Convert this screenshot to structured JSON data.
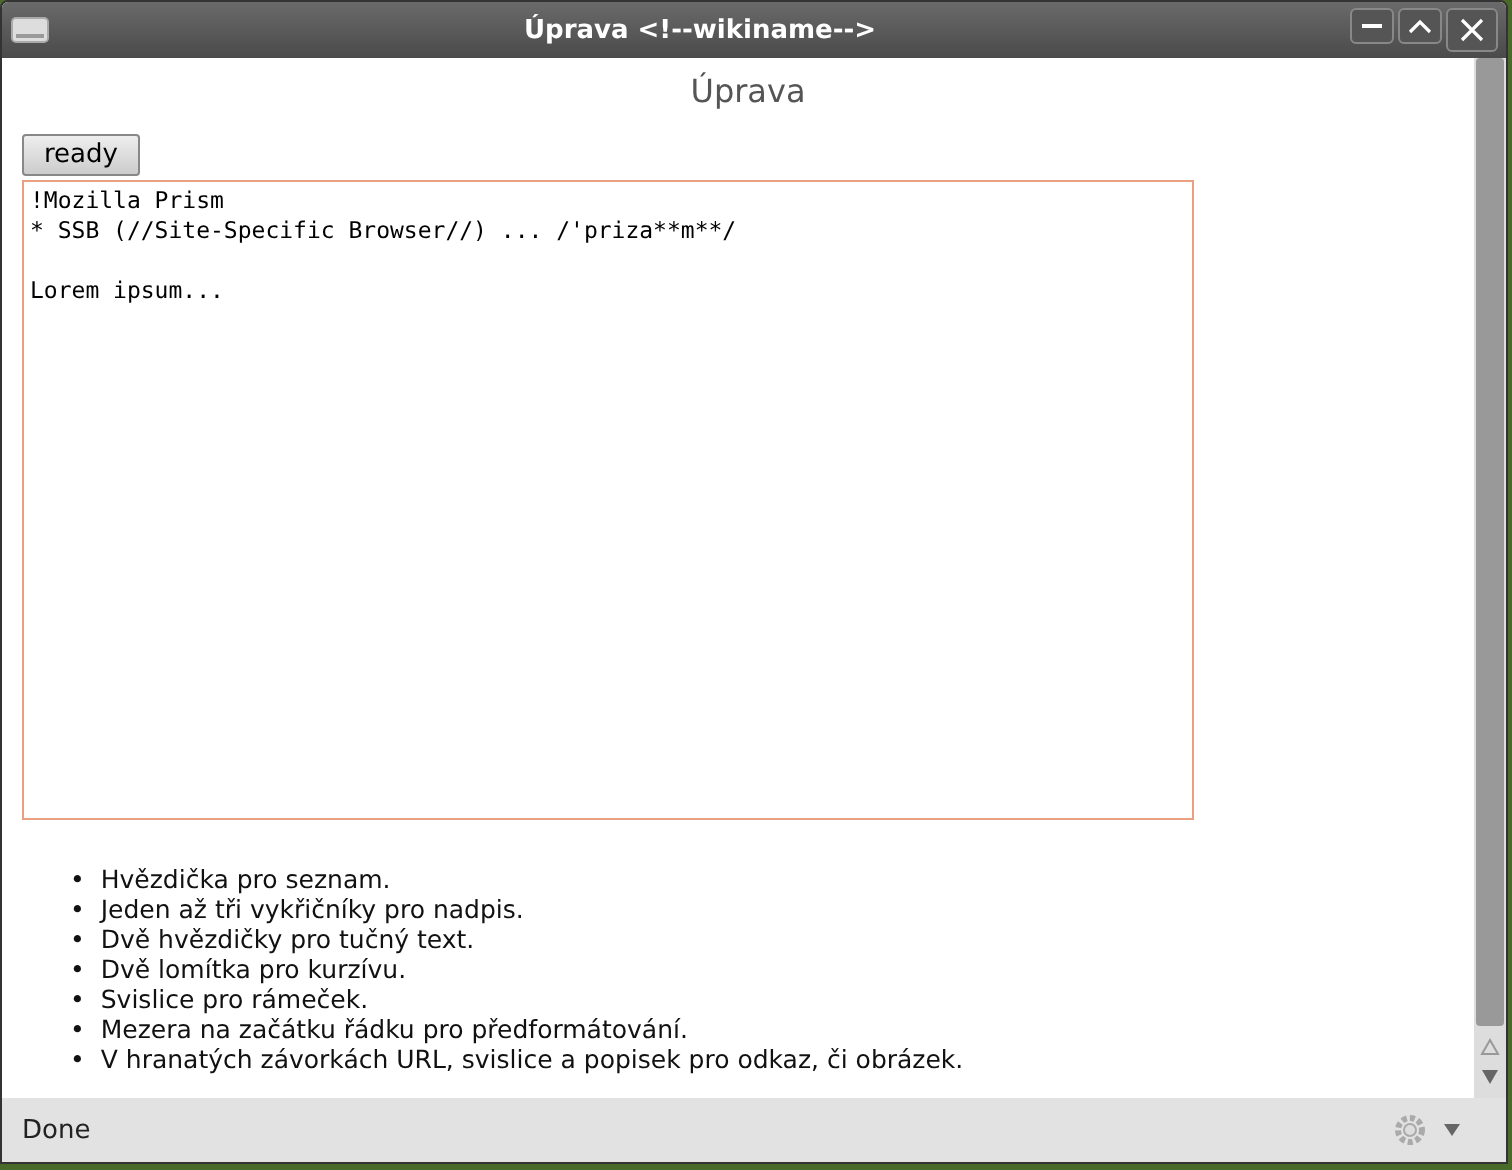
{
  "window": {
    "title": "Úprava <!--wikiname-->"
  },
  "heading": "Úprava",
  "ready_button": "ready",
  "editor": {
    "value": "!Mozilla Prism\n* SSB (//Site-Specific Browser//) ... /'priza**m**/\n\nLorem ipsum..."
  },
  "help": [
    {
      "bullet": "•",
      "text": "Hvězdička pro seznam."
    },
    {
      "bullet": "•",
      "text": "Jeden až tři vykřičníky pro nadpis."
    },
    {
      "bullet": "•",
      "text": "Dvě hvězdičky pro tučný text."
    },
    {
      "bullet": "•",
      "text": "Dvě lomítka pro kurzívu."
    },
    {
      "bullet": "•",
      "text": "Svislice pro rámeček."
    },
    {
      "bullet": "•",
      "text": "Mezera na začátku řádku pro předformátování."
    },
    {
      "bullet": "•",
      "text": "V hranatých závorkách URL, svislice a popisek pro odkaz, či obrázek."
    }
  ],
  "status_bar": {
    "text": "Done"
  }
}
